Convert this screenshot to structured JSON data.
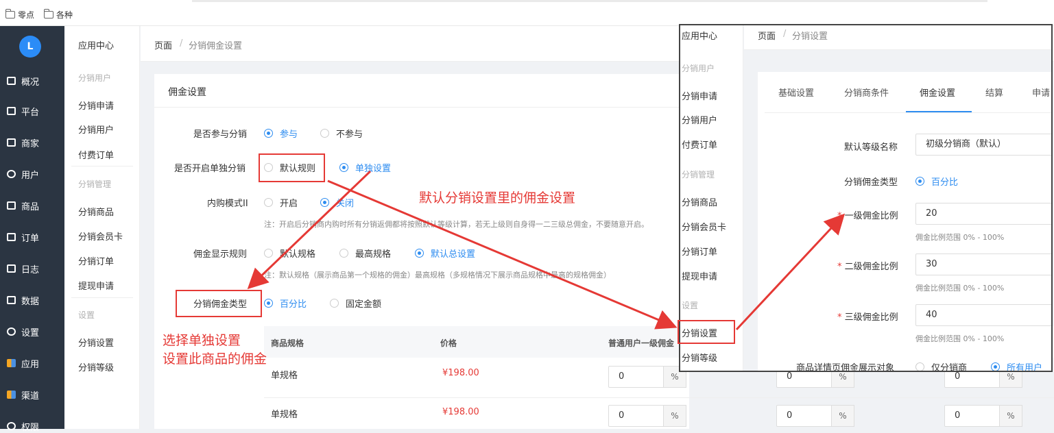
{
  "bookmarks": {
    "item1": "零点",
    "item2": "各种"
  },
  "sidebar": {
    "logo": "L",
    "items": [
      "概况",
      "平台",
      "商家",
      "用户",
      "商品",
      "订单",
      "日志",
      "数据",
      "设置",
      "应用",
      "渠道",
      "权限"
    ]
  },
  "subnav": {
    "title": "应用中心",
    "group1": "分销用户",
    "g1_items": [
      "分销申请",
      "分销用户",
      "付费订单"
    ],
    "group2": "分销管理",
    "g2_items": [
      "分销商品",
      "分销会员卡",
      "分销订单",
      "提现申请"
    ],
    "group3": "设置",
    "g3_items": [
      "分销设置",
      "分销等级"
    ]
  },
  "breadcrumb": {
    "root": "页面",
    "sep": "/",
    "current": "分销佣金设置"
  },
  "card": {
    "header": "佣金设置",
    "participate": {
      "label": "是否参与分销",
      "opt1": "参与",
      "opt2": "不参与"
    },
    "single": {
      "label": "是否开启单独分销",
      "opt1": "默认规则",
      "opt2": "单独设置"
    },
    "inner": {
      "label": "内购模式II",
      "opt1": "开启",
      "opt2": "关闭",
      "note": "注：开启后分销商内购时所有分销返佣都将按照默认等级计算，若无上级则自身得一二三级总佣金，不要随意开启。"
    },
    "display": {
      "label": "佣金显示规则",
      "opt1": "默认规格",
      "opt2": "最高规格",
      "opt3": "默认总设置",
      "note": "注：默认规格（展示商品第一个规格的佣金）最高规格（多规格情况下展示商品规格中最高的规格佣金）"
    },
    "type": {
      "label": "分销佣金类型",
      "opt1": "百分比",
      "opt2": "固定金额"
    },
    "table": {
      "headers": [
        "商品规格",
        "价格",
        "普通用户一级佣金"
      ],
      "rows": [
        {
          "spec": "单规格",
          "price": "¥198.00",
          "v1": "0",
          "v2": "0",
          "v3": "0"
        },
        {
          "spec": "单规格",
          "price": "¥198.00",
          "v1": "0",
          "v2": "0",
          "v3": "0"
        }
      ],
      "unit": "%"
    }
  },
  "annotations": {
    "a1": "默认分销设置里的佣金设置",
    "a2_line1": "选择单独设置",
    "a2_line2": "设置此商品的佣金"
  },
  "overlay": {
    "nav": {
      "title": "应用中心",
      "group1": "分销用户",
      "g1_items": [
        "分销申请",
        "分销用户",
        "付费订单"
      ],
      "group2": "分销管理",
      "g2_items": [
        "分销商品",
        "分销会员卡",
        "分销订单",
        "提现申请"
      ],
      "group3": "设置",
      "g3_items": [
        "分销设置",
        "分销等级"
      ]
    },
    "breadcrumb": {
      "root": "页面",
      "sep": "/",
      "current": "分销设置"
    },
    "tabs": [
      "基础设置",
      "分销商条件",
      "佣金设置",
      "结算",
      "申请"
    ],
    "form": {
      "level_name_label": "默认等级名称",
      "level_name_value": "初级分销商（默认）",
      "type_label": "分销佣金类型",
      "type_value": "百分比",
      "first_label": "一级佣金比例",
      "first_value": "20",
      "second_label": "二级佣金比例",
      "second_value": "30",
      "third_label": "三级佣金比例",
      "third_value": "40",
      "range_hint": "佣金比例范围 0% - 100%",
      "show_label": "商品详情页佣金展示对象",
      "show_opt1": "仅分销商",
      "show_opt2": "所有用户",
      "required_mark": "*"
    }
  },
  "colors": {
    "accent": "#2d8cf0",
    "annotation": "#e53935",
    "sidebar": "#2b3542"
  }
}
